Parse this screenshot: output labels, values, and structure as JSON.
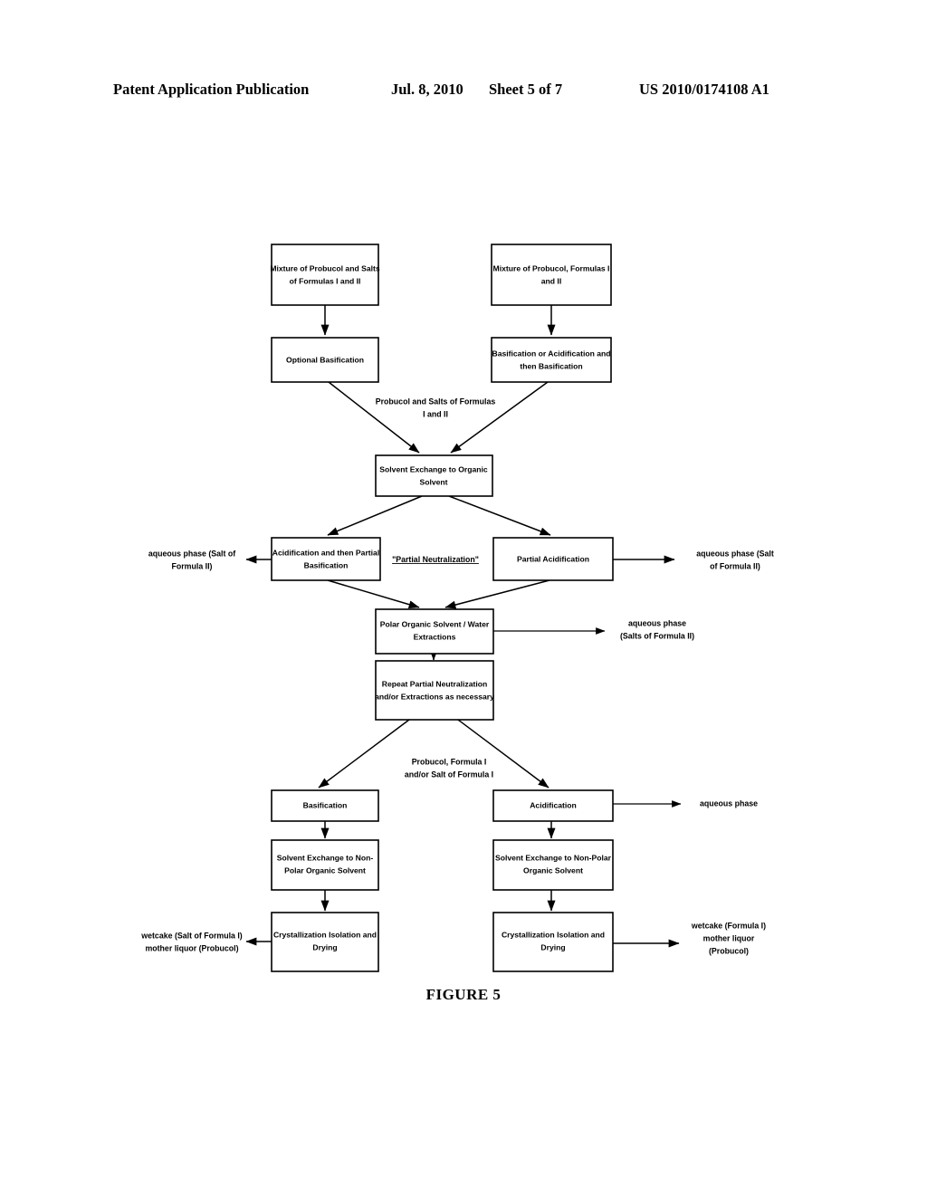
{
  "header": {
    "title": "Patent Application Publication",
    "date": "Jul. 8, 2010",
    "sheet": "Sheet 5 of 7",
    "number": "US 2010/0174108 A1"
  },
  "figure": {
    "caption": "FIGURE 5"
  },
  "flowchart": {
    "nodes": {
      "mixture_salts": "Mixture of Probucol and Salts of Formulas I and II",
      "mixture_salts_l1": "Mixture of Probucol and Salts",
      "mixture_salts_l2": "of Formulas I and II",
      "mixture_formulas": "Mixture of Probucol, Formulas I and II",
      "mixture_formulas_l1": "Mixture of Probucol, Formulas I",
      "mixture_formulas_l2": "and II",
      "optional_basification": "Optional Basification",
      "basification_or_acidification_l1": "Basification or Acidification and",
      "basification_or_acidification_l2": "then Basification",
      "solvent_exchange_organic_l1": "Solvent Exchange to Organic",
      "solvent_exchange_organic_l2": "Solvent",
      "acidification_partial_basification_l1": "Acidification and then Partial",
      "acidification_partial_basification_l2": "Basification",
      "partial_acidification": "Partial Acidification",
      "polar_extractions_l1": "Polar Organic Solvent / Water",
      "polar_extractions_l2": "Extractions",
      "repeat_neutralization_l1": "Repeat Partial Neutralization",
      "repeat_neutralization_l2": "and/or Extractions as necessary",
      "basification": "Basification",
      "acidification": "Acidification",
      "solvent_exchange_nonpolar_left_l1": "Solvent Exchange to Non-",
      "solvent_exchange_nonpolar_left_l2": "Polar Organic Solvent",
      "solvent_exchange_nonpolar_right_l1": "Solvent Exchange to Non-Polar",
      "solvent_exchange_nonpolar_right_l2": "Organic Solvent",
      "crystallization_left_l1": "Crystallization Isolation and",
      "crystallization_left_l2": "Drying",
      "crystallization_right_l1": "Crystallization Isolation and",
      "crystallization_right_l2": "Drying"
    },
    "edge_labels": {
      "probucol_salts_l1": "Probucol and Salts of Formulas",
      "probucol_salts_l2": "I and II",
      "partial_neutralization": "\"Partial Neutralization\"",
      "probucol_formula_l1": "Probucol, Formula I",
      "probucol_formula_l2": "and/or Salt of Formula I"
    },
    "side_labels": {
      "aqueous_left_l1": "aqueous phase (Salt of",
      "aqueous_left_l2": "Formula II)",
      "aqueous_right_l1": "aqueous phase (Salt",
      "aqueous_right_l2": "of Formula II)",
      "aqueous_extraction_l1": "aqueous phase",
      "aqueous_extraction_l2": "(Salts of Formula II)",
      "aqueous_phase": "aqueous phase",
      "wetcake_left_l1": "wetcake (Salt of Formula I)",
      "wetcake_left_l2": "mother liquor (Probucol)",
      "wetcake_right_l1": "wetcake (Formula I)",
      "wetcake_right_l2": "mother liquor",
      "wetcake_right_l3": "(Probucol)"
    }
  }
}
